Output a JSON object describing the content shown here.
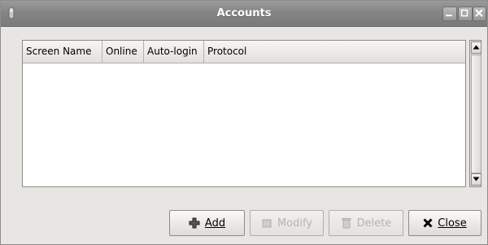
{
  "window": {
    "title": "Accounts"
  },
  "accounts_list": {
    "columns": [
      "Screen Name",
      "Online",
      "Auto-login",
      "Protocol"
    ],
    "rows": []
  },
  "buttons": {
    "add": "Add",
    "modify": "Modify",
    "delete": "Delete",
    "close": "Close"
  },
  "colors": {
    "titlebar": "#858585",
    "window_bg": "#e8e6e2",
    "list_bg": "#ffffff"
  }
}
